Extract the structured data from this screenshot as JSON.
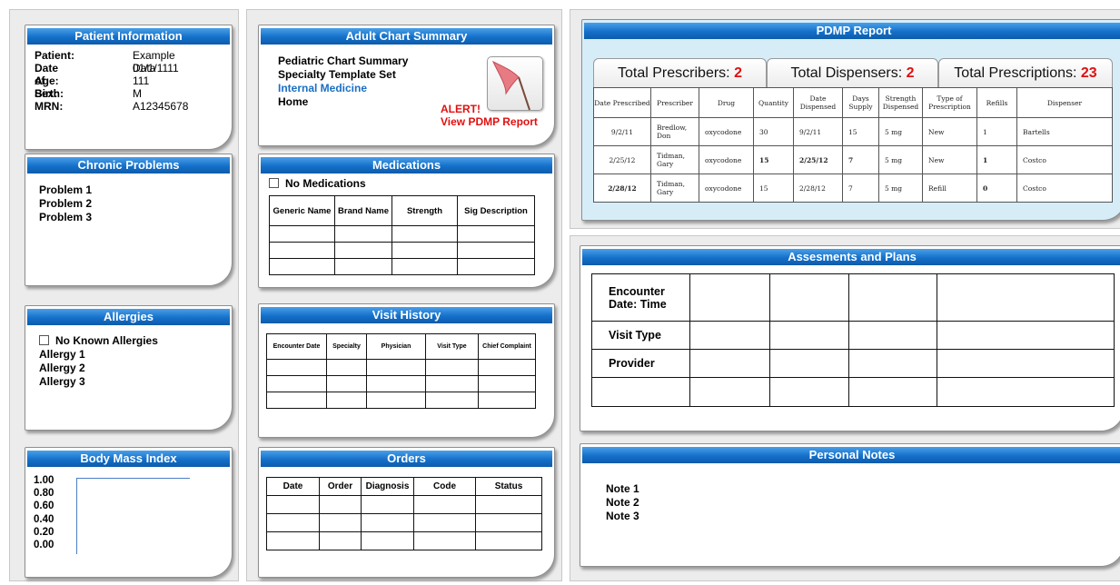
{
  "patient_info": {
    "title": "Patient Information",
    "rows": [
      {
        "label": "Patient:",
        "value": "Example Data"
      },
      {
        "label": "Date of Birth:",
        "value": "01/1/1111"
      },
      {
        "label": "Age:",
        "value": "111"
      },
      {
        "label": "Sex:",
        "value": "M"
      },
      {
        "label": "MRN:",
        "value": "A12345678"
      }
    ]
  },
  "chronic_problems": {
    "title": "Chronic Problems",
    "items": [
      "Problem 1",
      "Problem 2",
      "Problem 3"
    ]
  },
  "allergies": {
    "title": "Allergies",
    "no_known_label": "No Known Allergies",
    "items": [
      "Allergy 1",
      "Allergy 2",
      "Allergy 3"
    ]
  },
  "bmi": {
    "title": "Body Mass Index",
    "ticks": [
      "1.00",
      "0.80",
      "0.60",
      "0.40",
      "0.20",
      "0.00"
    ]
  },
  "chart_summary": {
    "title": "Adult Chart Summary",
    "links": [
      "Pediatric Chart Summary",
      "Specialty Template Set",
      "Internal Medicine",
      "Home"
    ],
    "alert_label": "ALERT!",
    "alert_link": "View PDMP Report",
    "colors": {
      "active_link": "#1a6fc4",
      "alert": "#e01010"
    },
    "icon": "red-flag-icon"
  },
  "medications": {
    "title": "Medications",
    "no_meds_label": "No Medications",
    "columns": [
      "Generic Name",
      "Brand Name",
      "Strength",
      "Sig Description"
    ],
    "row_count": 3
  },
  "visit_history": {
    "title": "Visit History",
    "columns": [
      "Encounter Date",
      "Specialty",
      "Physician",
      "Visit Type",
      "Chief Complaint"
    ],
    "row_count": 3
  },
  "orders": {
    "title": "Orders",
    "columns": [
      "Date",
      "Order",
      "Diagnosis",
      "Code",
      "Status"
    ],
    "row_count": 3
  },
  "pdmp": {
    "title": "PDMP Report",
    "totals": [
      {
        "label": "Total Prescribers: ",
        "value": "2"
      },
      {
        "label": "Total Dispensers: ",
        "value": "2"
      },
      {
        "label": "Total Prescriptions: ",
        "value": "23"
      }
    ],
    "columns": [
      "Date Prescribed",
      "Prescriber",
      "Drug",
      "Quantity",
      "Date Dispensed",
      "Days Supply",
      "Strength Dispensed",
      "Type of Prescription",
      "Refills",
      "Dispenser"
    ],
    "rows": [
      [
        "9/2/11",
        "Bredlow, Don",
        "oxycodone",
        "30",
        "9/2/11",
        "15",
        "5 mg",
        "New",
        "1",
        "Bartells"
      ],
      [
        "2/25/12",
        "Tidman, Gary",
        "oxycodone",
        "15",
        "2/25/12",
        "7",
        "5 mg",
        "New",
        "1",
        "Costco"
      ],
      [
        "2/28/12",
        "Tidman, Gary",
        "oxycodone",
        "15",
        "2/28/12",
        "7",
        "5 mg",
        "Refill",
        "0",
        "Costco"
      ]
    ]
  },
  "assessments": {
    "title": "Assesments and Plans",
    "row_labels": [
      "Encounter Date: Time",
      "Visit Type",
      "Provider",
      ""
    ],
    "data_columns": 4
  },
  "personal_notes": {
    "title": "Personal Notes",
    "items": [
      "Note 1",
      "Note 2",
      "Note 3"
    ]
  }
}
